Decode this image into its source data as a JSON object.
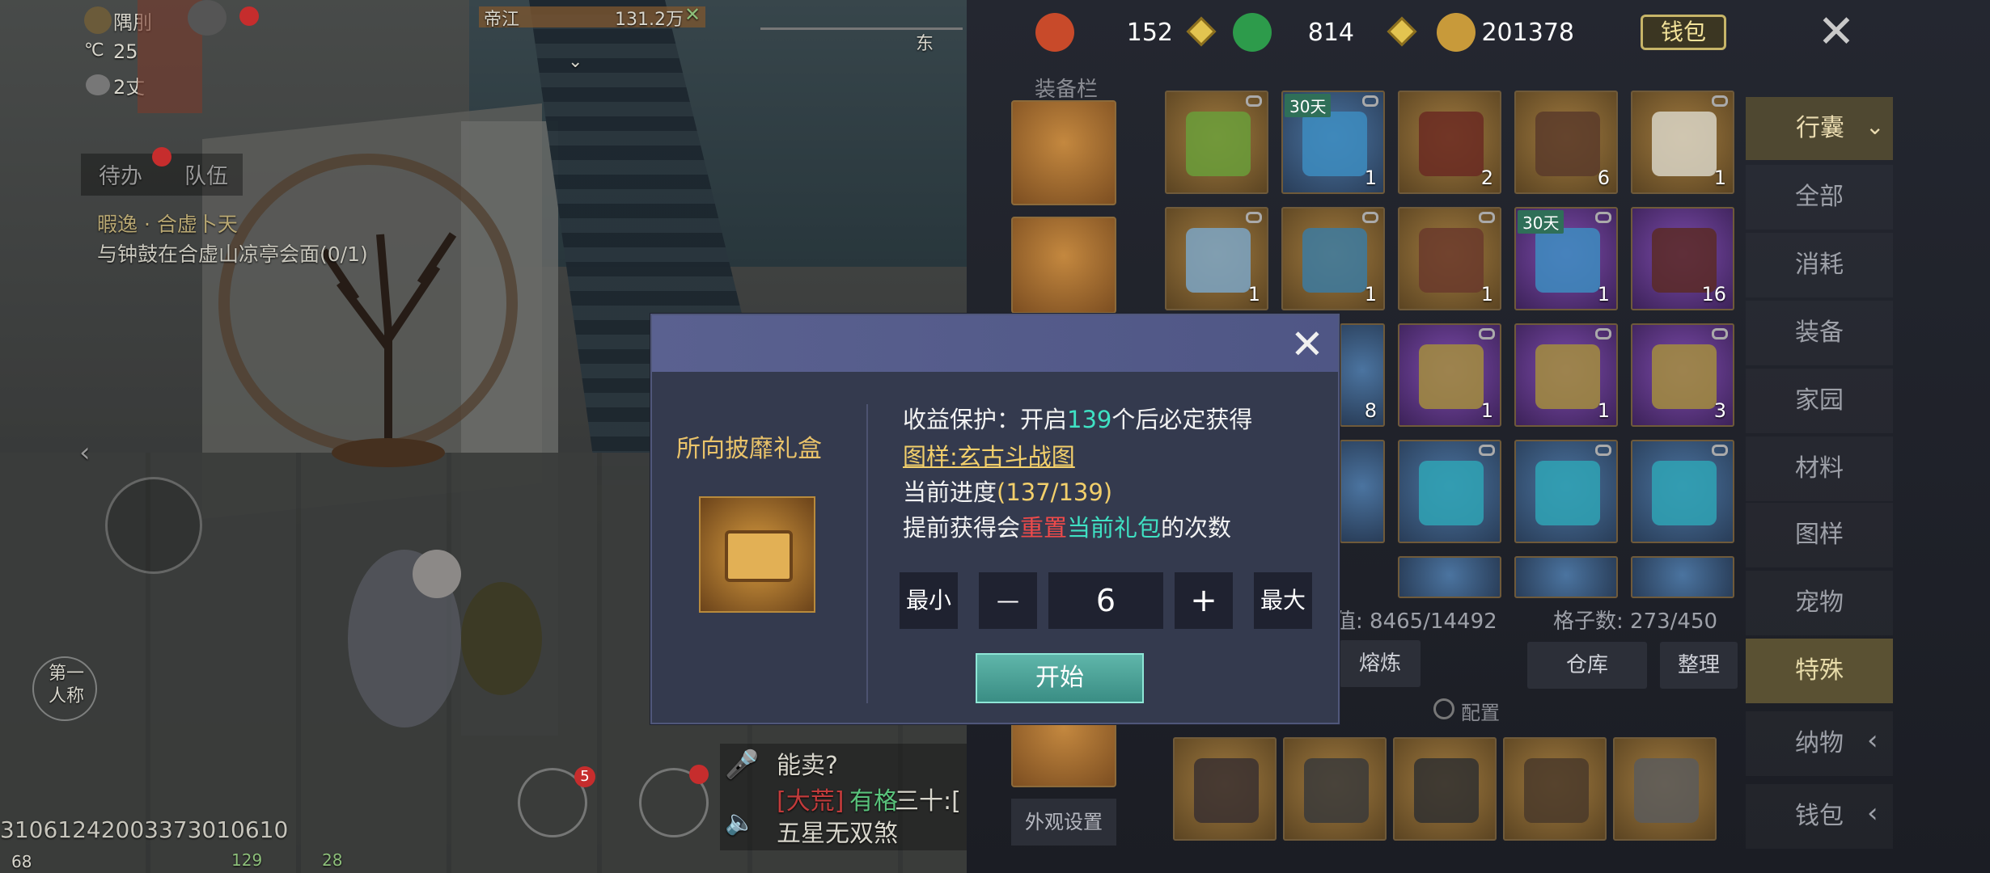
{
  "hud": {
    "location": "隅刖",
    "temperature": "25",
    "wind": "2丈",
    "enemy_name": "帝江",
    "enemy_hp": "131.2万",
    "compass_dir": "东",
    "tab_todo": "待办",
    "tab_team": "队伍",
    "quest_title": "暇逸 · 合虚卜天",
    "quest_desc": "与钟鼓在合虚山凉亭会面(0/1)",
    "view_toggle": "第一人称",
    "player_id": "31061242003373010610",
    "chat_line1": "能卖?",
    "chat_channel": "[大荒]",
    "chat_name": "有格",
    "chat_text": "三十:[",
    "chat_line2": "五星无双煞",
    "fps": "68",
    "badge_home": "5",
    "bottom_num1": "129",
    "bottom_num2": "28"
  },
  "currency": {
    "c1": "152",
    "c2": "814",
    "c3": "201378",
    "wallet": "钱包"
  },
  "equip_title": "装备栏",
  "appearance_btn": "外观设置",
  "items_row1": [
    {
      "qty": "",
      "badge": ""
    },
    {
      "qty": "1",
      "badge": "30天"
    },
    {
      "qty": "2",
      "badge": ""
    },
    {
      "qty": "6",
      "badge": ""
    },
    {
      "qty": "1",
      "badge": ""
    }
  ],
  "items_row2": [
    {
      "qty": "1",
      "badge": ""
    },
    {
      "qty": "1",
      "badge": ""
    },
    {
      "qty": "1",
      "badge": ""
    },
    {
      "qty": "1",
      "badge": "30天"
    },
    {
      "qty": "16",
      "badge": ""
    }
  ],
  "items_row3": [
    {
      "qty": "8"
    },
    {
      "qty": "1"
    },
    {
      "qty": "1"
    },
    {
      "qty": "3"
    }
  ],
  "stats": {
    "value": "值: 8465/14492",
    "slots": "格子数: 273/450"
  },
  "buttons": {
    "smelt": "熔炼",
    "warehouse": "仓库",
    "sort": "整理",
    "config": "配置"
  },
  "categories": {
    "bag": "行囊",
    "all": "全部",
    "consume": "消耗",
    "equip": "装备",
    "home": "家园",
    "material": "材料",
    "pattern": "图样",
    "pet": "宠物",
    "special": "特殊",
    "naw": "纳物",
    "wallet": "钱包"
  },
  "dialog": {
    "gift_name": "所向披靡礼盒",
    "line1_a": "收益保护：开启",
    "line1_num": "139",
    "line1_b": "个后必定获得",
    "line2": "图样:玄古斗战图",
    "line3_a": "当前进度",
    "line3_b": "(137/139)",
    "line4_a": "提前获得会",
    "line4_red": "重置",
    "line4_teal": "当前礼包",
    "line4_b": "的次数",
    "min": "最小",
    "max": "最大",
    "minus": "—",
    "plus": "+",
    "quantity": "6",
    "start": "开始"
  }
}
